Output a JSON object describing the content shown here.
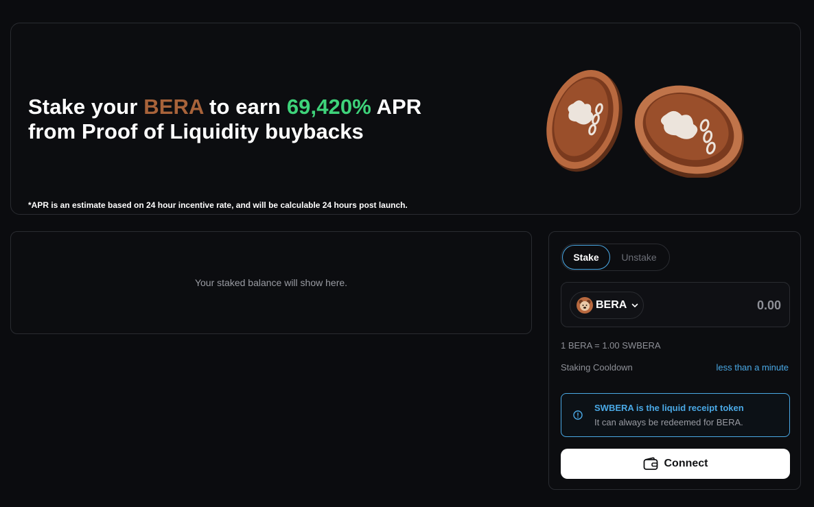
{
  "hero": {
    "title_part1": "Stake your ",
    "title_token": "BERA",
    "title_part2": " to earn ",
    "title_apr": "69,420%",
    "title_part3": " APR",
    "title_line2": "from Proof of Liquidity buybacks",
    "note": "*APR is an estimate based on 24 hour incentive rate, and will be calculable 24 hours post launch.",
    "illustration": "bera-coins-illustration"
  },
  "balance": {
    "empty_text": "Your staked balance will show here."
  },
  "stake_panel": {
    "tabs": [
      {
        "label": "Stake",
        "active": true
      },
      {
        "label": "Unstake",
        "active": false
      }
    ],
    "token": {
      "symbol": "BERA",
      "icon": "bear-token-icon"
    },
    "amount_placeholder": "0.00",
    "rate": "1 BERA = 1.00 SWBERA",
    "cooldown_label": "Staking Cooldown",
    "cooldown_value": "less than a minute",
    "info": {
      "title": "SWBERA is the liquid receipt token",
      "subtitle": "It can always be redeemed for BERA."
    },
    "connect_label": "Connect"
  },
  "colors": {
    "background": "#0b0c0f",
    "token_accent": "#a8633a",
    "apr_green": "#3ed37a",
    "info_blue": "#4aa9e6"
  }
}
